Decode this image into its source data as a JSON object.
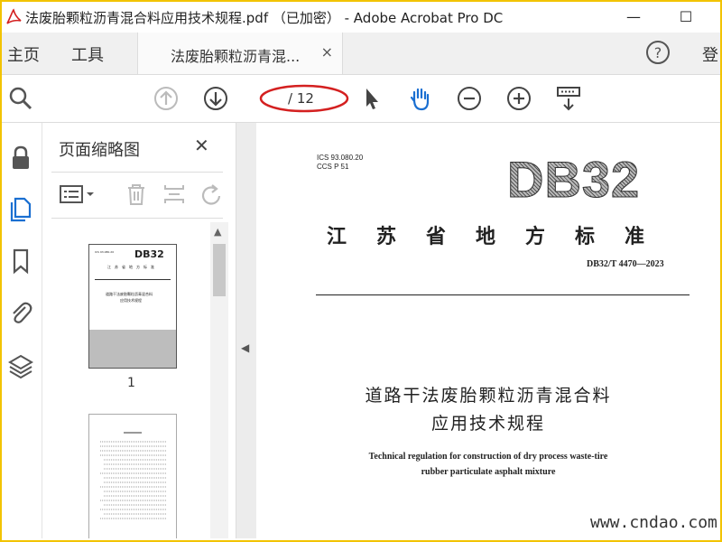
{
  "window": {
    "title": "法废胎颗粒沥青混合料应用技术规程.pdf （已加密） - Adobe Acrobat Pro DC",
    "minimize": "—",
    "maximize": "☐"
  },
  "tabs": {
    "home": "主页",
    "tools": "工具",
    "document": "法废胎颗粒沥青混...",
    "document_close": "×",
    "login": "登"
  },
  "toolbar": {
    "page_current": "",
    "page_total": "/ 12"
  },
  "thumbnails": {
    "title": "页面缩略图",
    "close": "✕",
    "page1_label": "1"
  },
  "document": {
    "ics": "ICS  93.080.20",
    "ccs": "CCS  P  51",
    "db_logo": "DB32",
    "standard_title": "江苏省地方标准",
    "standard_number": "DB32/T 4470—2023",
    "title_cn_line1": "道路干法废胎颗粒沥青混合料",
    "title_cn_line2": "应用技术规程",
    "title_en_line1": "Technical regulation for construction of dry process waste-tire",
    "title_en_line2": "rubber particulate asphalt mixture"
  },
  "watermark": "www.cndao.com",
  "colors": {
    "frame": "#f2c300",
    "annotation_ellipse": "#d42020",
    "hand_tool": "#1a6fd1",
    "active_rail_icon": "#1a6fd1"
  },
  "icons": [
    "search-icon",
    "previous-page-icon",
    "next-page-icon",
    "select-icon",
    "hand-icon",
    "zoom-out-icon",
    "zoom-in-icon",
    "page-display-icon",
    "lock-icon",
    "pages-icon",
    "bookmark-icon",
    "attachment-icon",
    "layers-icon",
    "options-icon",
    "delete-icon",
    "extract-icon",
    "rotate-icon",
    "help-icon"
  ]
}
